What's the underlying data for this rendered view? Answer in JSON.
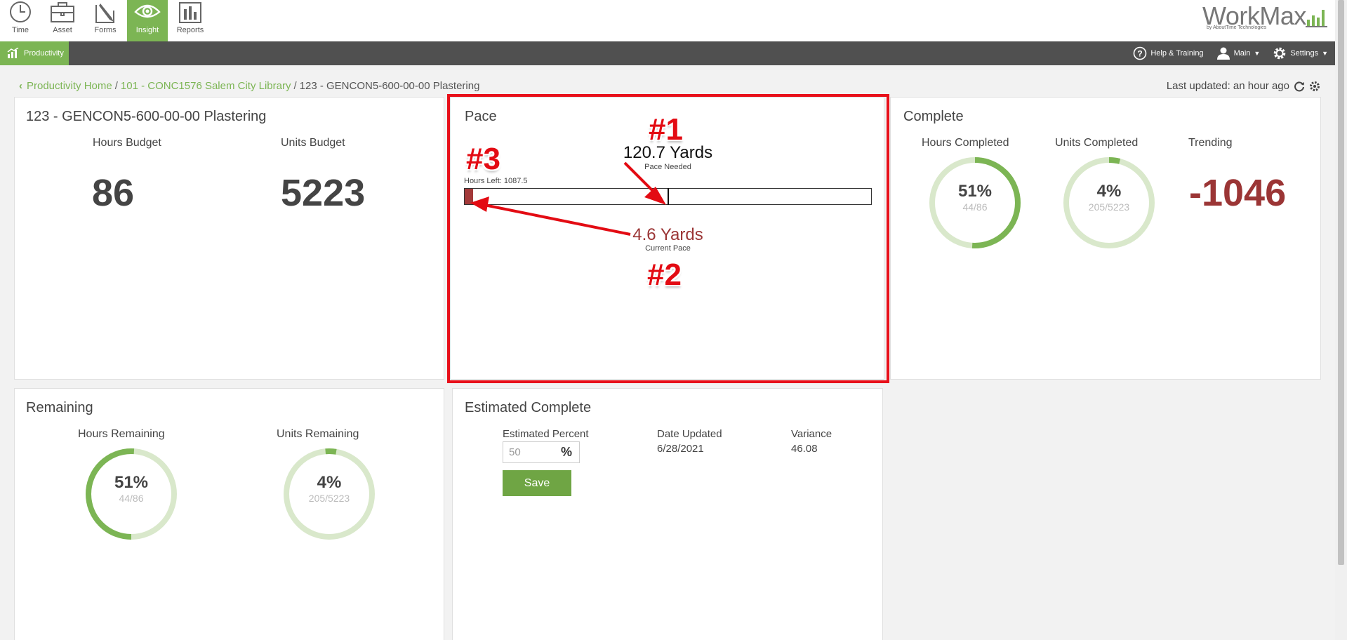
{
  "topnav": [
    {
      "label": "Time",
      "icon": "clock-icon"
    },
    {
      "label": "Asset",
      "icon": "briefcase-icon"
    },
    {
      "label": "Forms",
      "icon": "pencil-form-icon"
    },
    {
      "label": "Insight",
      "icon": "eye-icon"
    },
    {
      "label": "Reports",
      "icon": "bar-chart-icon"
    }
  ],
  "logo": {
    "word": "WorkMax",
    "tagline": "by AboutTime Technologies"
  },
  "darkbar": {
    "productivity": "Productivity",
    "help": "Help & Training",
    "main": "Main",
    "settings": "Settings"
  },
  "breadcrumb": {
    "home": "Productivity Home",
    "project": "101 - CONC1576 Salem City Library",
    "current": "123 - GENCON5-600-00-00 Plastering",
    "separator": "/"
  },
  "last_updated": "Last updated: an hour ago",
  "budget": {
    "title": "123 - GENCON5-600-00-00 Plastering",
    "hours_label": "Hours Budget",
    "hours_value": "86",
    "units_label": "Units Budget",
    "units_value": "5223"
  },
  "pace": {
    "title": "Pace",
    "needed_value": "120.7 Yards",
    "needed_label": "Pace Needed",
    "hours_left": "Hours Left: 1087.5",
    "current_value": "4.6 Yards",
    "current_label": "Current Pace",
    "current_fraction": 0.02,
    "needed_fraction": 0.5
  },
  "annotations": {
    "n1": "#1",
    "n2": "#2",
    "n3": "#3"
  },
  "complete": {
    "title": "Complete",
    "hours_label": "Hours Completed",
    "hours_pct": "51%",
    "hours_frac": "44/86",
    "hours_fraction": 0.51,
    "units_label": "Units Completed",
    "units_pct": "4%",
    "units_frac": "205/5223",
    "units_fraction": 0.04,
    "trending_label": "Trending",
    "trending_value": "-1046"
  },
  "remaining": {
    "title": "Remaining",
    "hours_label": "Hours Remaining",
    "hours_pct": "51%",
    "hours_frac": "44/86",
    "hours_fraction": 0.51,
    "units_label": "Units Remaining",
    "units_pct": "4%",
    "units_frac": "205/5223",
    "units_fraction": 0.04
  },
  "estimated": {
    "title": "Estimated Complete",
    "percent_label": "Estimated Percent",
    "percent_value": "50",
    "percent_sign": "%",
    "save_label": "Save",
    "date_label": "Date Updated",
    "date_value": "6/28/2021",
    "variance_label": "Variance",
    "variance_value": "46.08"
  },
  "colors": {
    "accent": "#7cb554",
    "ring_track": "#d9e8cb",
    "trending": "#9b3535",
    "pace_fill": "#a33a3a",
    "annotation": "#e30b13"
  }
}
